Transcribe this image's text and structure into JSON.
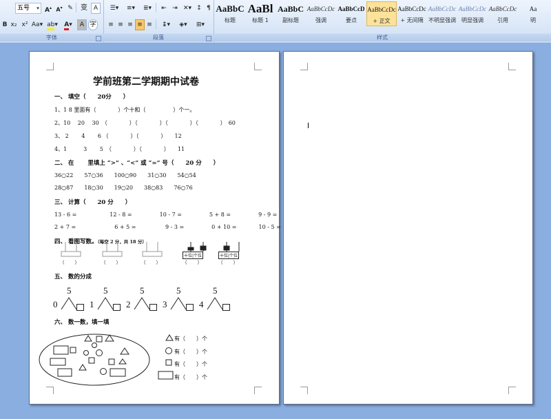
{
  "ribbon": {
    "font_size": "五号",
    "font_group_label": "字体",
    "paragraph_group_label": "段落",
    "styles_group_label": "样式",
    "styles": [
      {
        "sample": "AaBbC",
        "name": "标题"
      },
      {
        "sample": "AaBl",
        "name": "标题 1"
      },
      {
        "sample": "AaBbC",
        "name": "副标题"
      },
      {
        "sample": "AaBbCcDc",
        "name": "强调"
      },
      {
        "sample": "AaBbCcD",
        "name": "要点"
      },
      {
        "sample": "AaBbCcDc",
        "name": "+ 正文"
      },
      {
        "sample": "AaBbCcDc",
        "name": "+ 无间隔"
      },
      {
        "sample": "AaBbCcDc",
        "name": "不明显强调"
      },
      {
        "sample": "AaBbCcDc",
        "name": "明显强调"
      },
      {
        "sample": "AaBbCcDc",
        "name": "引用"
      },
      {
        "sample": "Aa",
        "name": "明"
      }
    ],
    "selected_style": "+ 正文"
  },
  "doc": {
    "title": "学前班第二学期期中试卷",
    "s1": "一、 填空（　　20分　　）",
    "s1_lines": [
      "1、1 8 里面有（　　　　）个十和（　　　　　）个一。",
      "2、10　 20　 30　（　　　　）（　　　　）（　　　　）（　　　　）　60",
      "3、 2　　 4　　 6 （　　　　）（　　　　）　　12",
      "4、1　　　3　　 5　（　　　　）（　　　　）　　11"
    ],
    "s2": "二、 在　　 里填上 “>” 、“<” 或 “=” 号（　　20 分　　）",
    "s2_rows": [
      "36○22　　57○36　　100○90　　31○30　　54○54",
      "28○87　　18○30　　19○20　　38○83　　76○76"
    ],
    "s3": "三、 计算（　　20 分　　）",
    "s3_rows": [
      "13 - 6 =　　　　　　12 - 8 =　　　　　10 - 7 =　　　　　5 + 8 =　　　　　9 - 9 =",
      "2 + 7 =　　　　　　　6 + 5 =　　　　　 9 - 3 =　　　　　0 + 10 =　　　　10 - 5 ="
    ],
    "s4": "四、 看图写数。",
    "s4_note": "（每空 2 分，共 18 分）",
    "abacus_blanks": "（　　 ）",
    "tens_label": "十位",
    "ones_label": "个位",
    "s5": "五、 数的分成",
    "split_top": [
      "5",
      "5",
      "5",
      "5",
      "5"
    ],
    "split_left": [
      "0",
      "1",
      "2",
      "3",
      "4"
    ],
    "s6": "六、 数一数，填一填",
    "count_lines": [
      "有（　　）个",
      "有（　　）个",
      "有（　　）个",
      "有（　　）个"
    ]
  }
}
